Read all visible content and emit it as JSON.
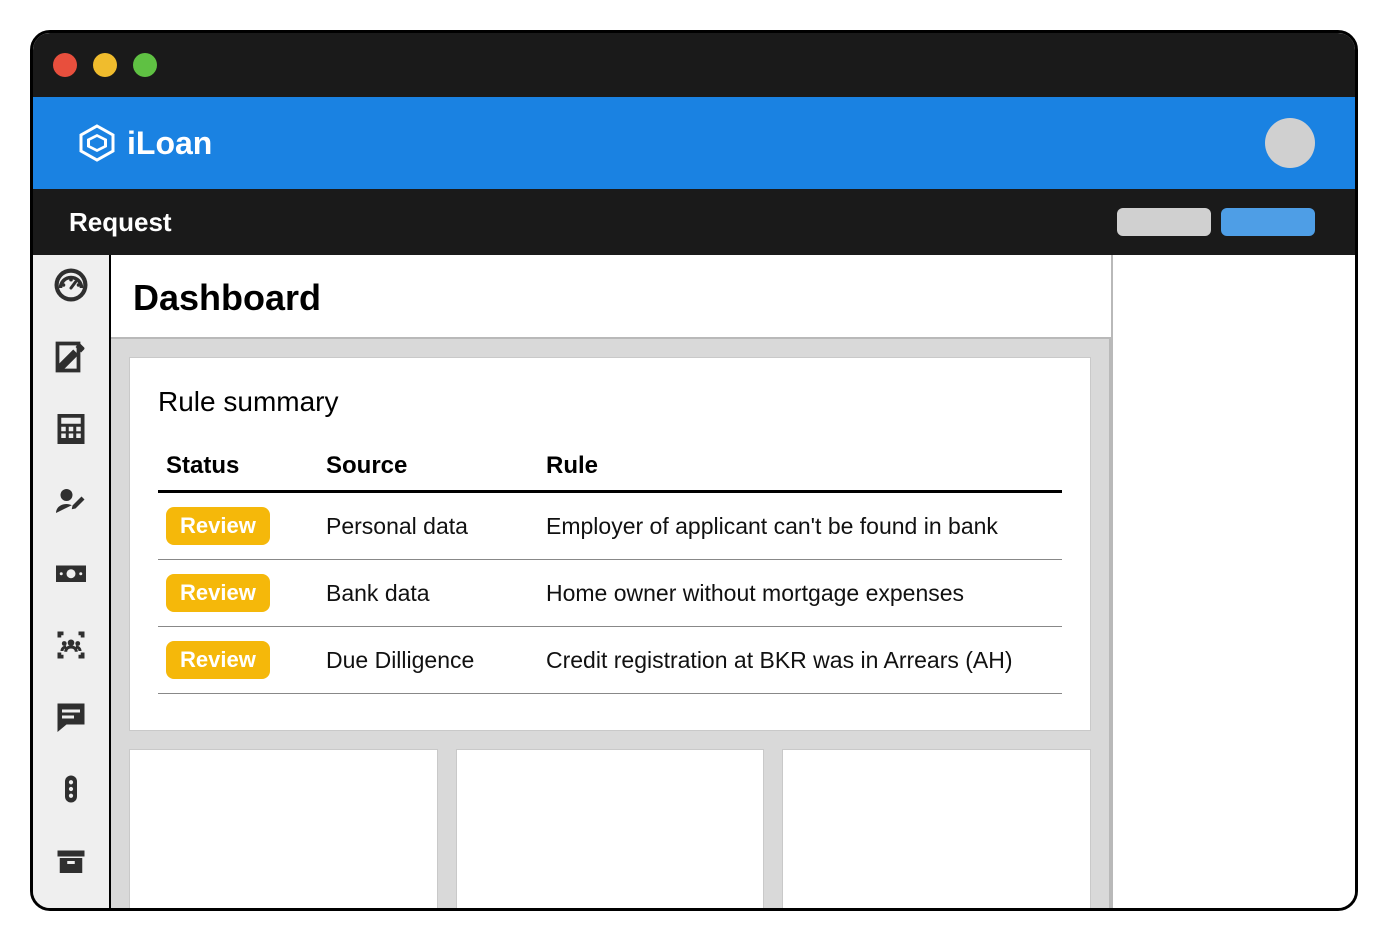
{
  "brand": {
    "name": "iLoan"
  },
  "subbar": {
    "title": "Request"
  },
  "page": {
    "title": "Dashboard"
  },
  "rule_summary": {
    "title": "Rule summary",
    "headers": {
      "status": "Status",
      "source": "Source",
      "rule": "Rule"
    },
    "rows": [
      {
        "status": "Review",
        "source": "Personal data",
        "rule": "Employer of applicant can't be found in bank"
      },
      {
        "status": "Review",
        "source": "Bank data",
        "rule": "Home owner without mortgage expenses"
      },
      {
        "status": "Review",
        "source": "Due Dilligence",
        "rule": "Credit registration at BKR was in Arrears (AH)"
      }
    ]
  },
  "colors": {
    "brand_blue": "#1a82e2",
    "badge_yellow": "#f5b80a"
  }
}
